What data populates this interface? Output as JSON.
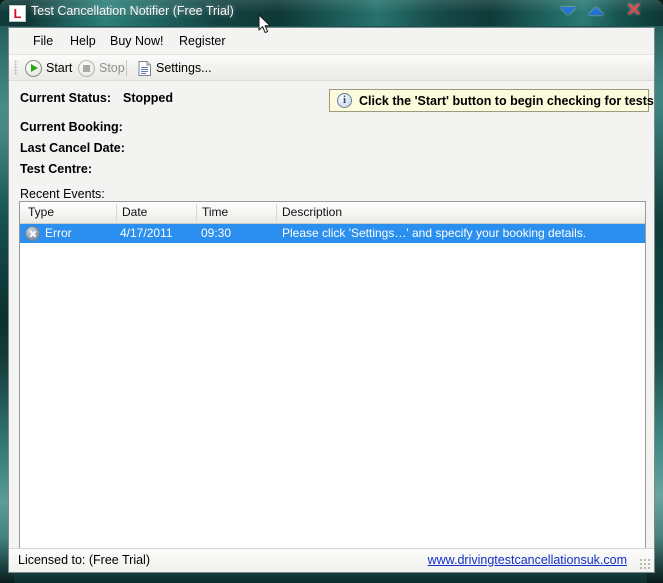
{
  "window": {
    "title": "Test Cancellation Notifier (Free Trial)",
    "app_icon_glyph": "L",
    "accent_color": "#1f6fd6",
    "close_color": "#d9454a",
    "titlebar_color": "#1a5754",
    "controls": {
      "minimize_label": "",
      "maximize_label": "",
      "close_label": "✕"
    }
  },
  "menu": {
    "items": [
      {
        "label": "File"
      },
      {
        "label": "Help"
      },
      {
        "label": "Buy Now!"
      },
      {
        "label": "Register"
      }
    ]
  },
  "toolbar": {
    "start_label": "Start",
    "stop_label": "Stop",
    "settings_label": "Settings..."
  },
  "status_fields": [
    {
      "label": "Current Status:",
      "value": "Stopped"
    },
    {
      "label": "Current Booking:",
      "value": ""
    },
    {
      "label": "Last Cancel Date:",
      "value": ""
    },
    {
      "label": "Test Centre:",
      "value": ""
    }
  ],
  "info_banner": {
    "icon_glyph": "i",
    "text": "Click the 'Start' button to begin checking for tests.",
    "background_color": "#fcfbdc",
    "border_color": "#9a9a7e"
  },
  "recent_events": {
    "section_label": "Recent Events:",
    "columns": [
      "Type",
      "Date",
      "Time",
      "Description"
    ],
    "selection_color": "#2a8fee",
    "rows": [
      {
        "type": "Error",
        "date": "4/17/2011",
        "time": "09:30",
        "description": "Please click 'Settings…' and specify your booking details.",
        "selected": true
      }
    ]
  },
  "status_bar": {
    "license": "Licensed to: (Free Trial)",
    "link": "www.drivingtestcancellationsuk.com",
    "link_color": "#1330c6"
  }
}
